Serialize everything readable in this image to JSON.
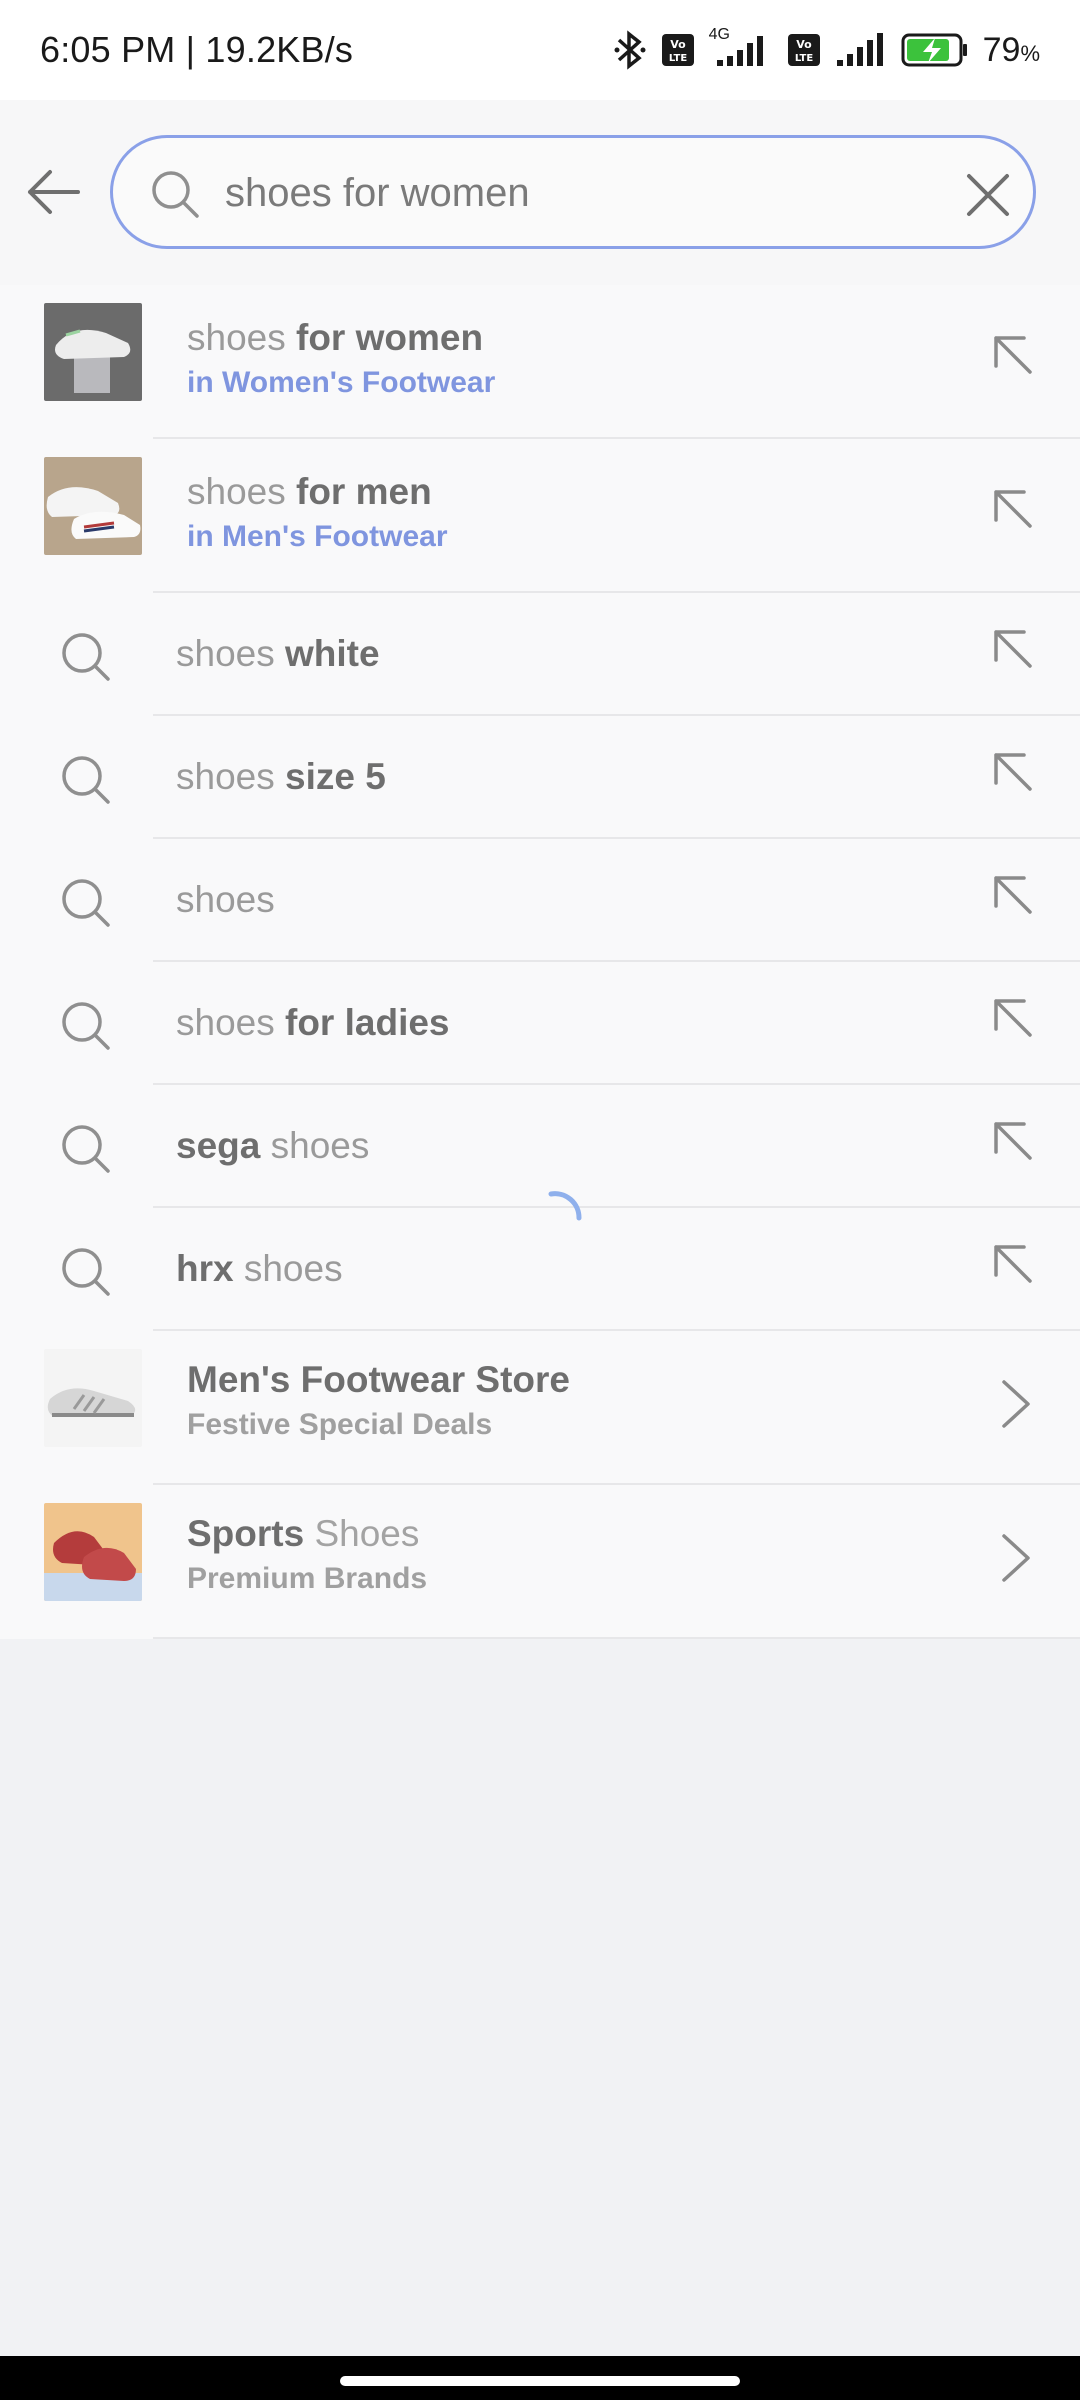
{
  "status_bar": {
    "time": "6:05 PM | 19.2KB/s",
    "network": "4G",
    "battery_percent": "79",
    "battery_unit": "%"
  },
  "search": {
    "value": "shoes for women",
    "placeholder": ""
  },
  "suggestions": [
    {
      "type": "category",
      "prefix": "shoes",
      "bold": " for women",
      "category": "in Women's Footwear",
      "thumb": "white-sneakers"
    },
    {
      "type": "category",
      "prefix": "shoes",
      "bold": " for men",
      "category": "in Men's Footwear",
      "thumb": "white-sneakers-stripe"
    },
    {
      "type": "query",
      "prefix": "shoes",
      "bold": " white",
      "suffix": ""
    },
    {
      "type": "query",
      "prefix": "shoes",
      "bold": " size 5",
      "suffix": ""
    },
    {
      "type": "query",
      "prefix": "shoes",
      "bold": "",
      "suffix": ""
    },
    {
      "type": "query",
      "prefix": "shoes",
      "bold": " for ladies",
      "suffix": ""
    },
    {
      "type": "query",
      "prefix": "",
      "bold": "sega",
      "suffix": " shoes"
    },
    {
      "type": "query",
      "prefix": "",
      "bold": "hrx",
      "suffix": " shoes"
    }
  ],
  "stores": [
    {
      "title_bold": "Men's Footwear Store",
      "title_light": "",
      "subtitle": "Festive Special Deals",
      "thumb": "grey-running-shoe"
    },
    {
      "title_bold": "Sports",
      "title_light": " Shoes",
      "subtitle": "Premium Brands",
      "thumb": "red-sports-shoes"
    }
  ],
  "colors": {
    "accent": "#8aa0e8",
    "category_text": "#7f95df",
    "background": "#f1f2f4"
  }
}
